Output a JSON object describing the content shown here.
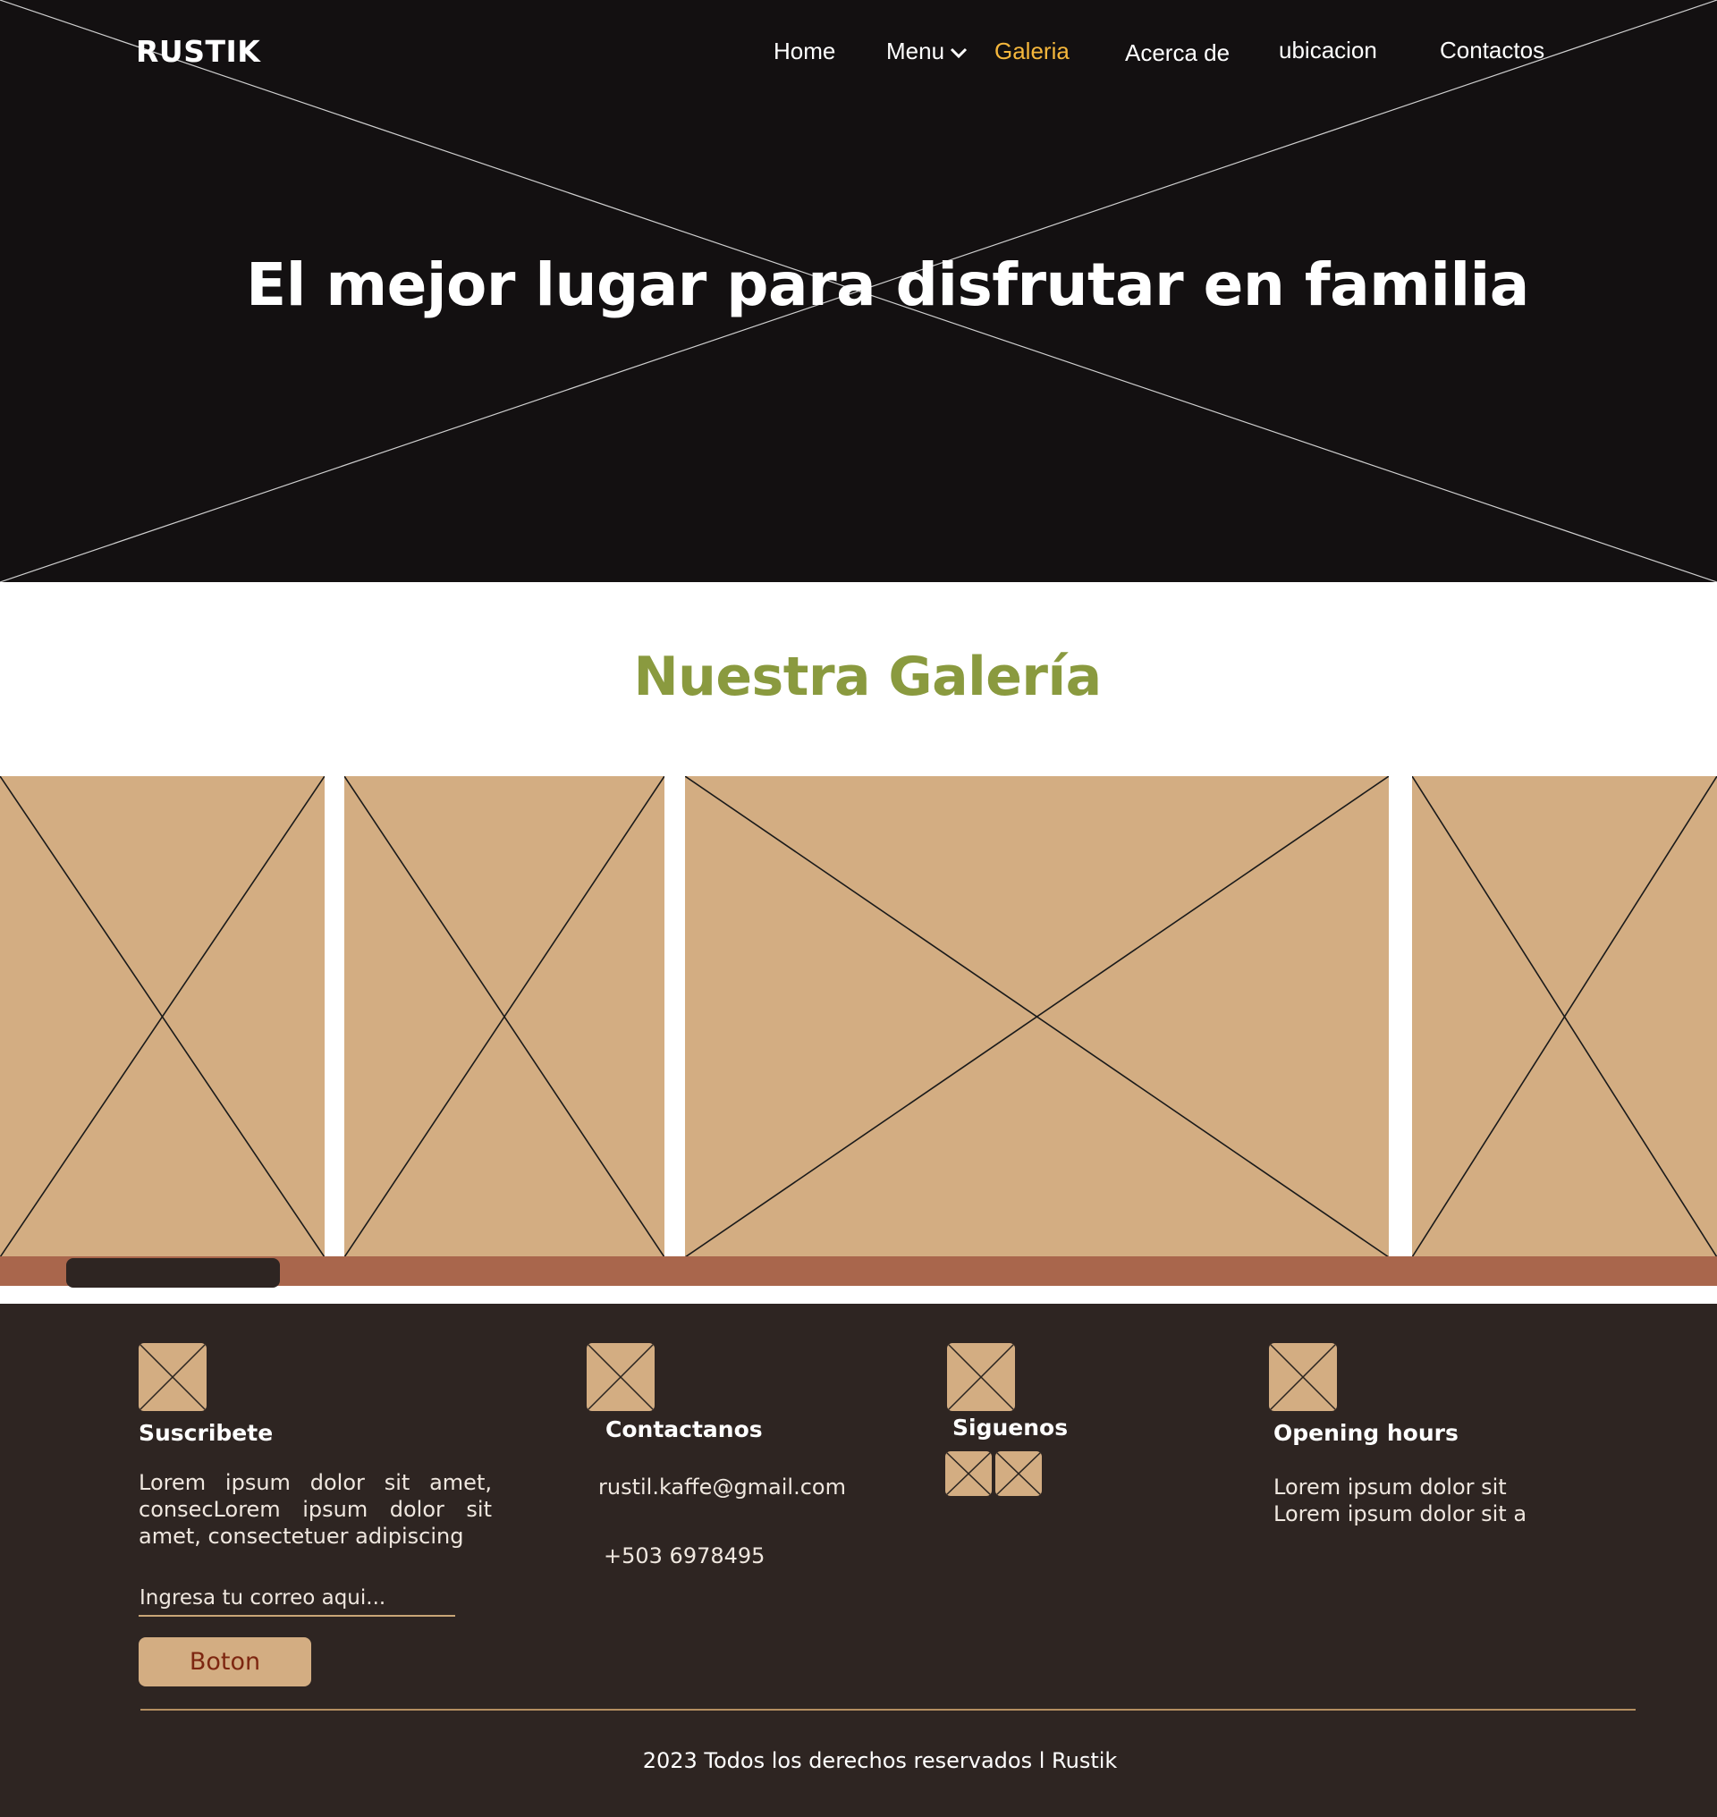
{
  "header": {
    "logo": "RUSTIK",
    "nav": [
      {
        "label": "Home"
      },
      {
        "label": "Menu"
      },
      {
        "label": "Galeria"
      },
      {
        "label": "Acerca de"
      },
      {
        "label": "ubicacion"
      },
      {
        "label": "Contactos"
      }
    ],
    "active_nav": "Galeria"
  },
  "hero": {
    "title": "El mejor lugar para disfrutar en familia"
  },
  "gallery": {
    "title": "Nuestra Galería",
    "images": [
      {
        "icon": "image-placeholder-icon"
      },
      {
        "icon": "image-placeholder-icon"
      },
      {
        "icon": "image-placeholder-icon"
      },
      {
        "icon": "image-placeholder-icon"
      }
    ]
  },
  "footer": {
    "subscribe": {
      "heading": "Suscribete",
      "text": "Lorem ipsum dolor sit amet, consecLorem ipsum dolor sit amet, consectetuer adipiscing",
      "email_placeholder": "Ingresa tu correo aqui...",
      "button_label": "Boton"
    },
    "contact": {
      "heading": "Contactanos",
      "email": "rustil.kaffe@gmail.com",
      "phone": "+503 6978495"
    },
    "follow": {
      "heading": "Siguenos"
    },
    "hours": {
      "heading": "Opening hours",
      "lines": [
        "Lorem ipsum dolor sit",
        "Lorem ipsum dolor sit a"
      ]
    },
    "copyright": "2023 Todos los derechos reservados l Rustik"
  },
  "colors": {
    "hero_bg": "#131011",
    "accent_nav": "#f5b73c",
    "gallery_title": "#8a9a3f",
    "placeholder": "#d3ad82",
    "scroll_track": "#a9664c",
    "footer_bg": "#2e2522",
    "button_text": "#7d2610"
  }
}
